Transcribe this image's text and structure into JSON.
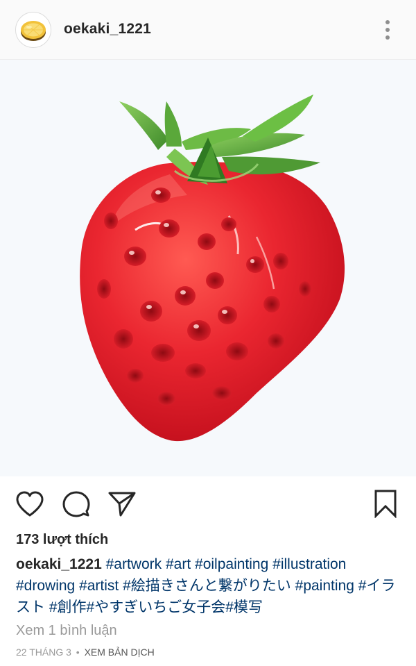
{
  "post": {
    "username": "oekaki_1221",
    "likes_text": "173 lượt thích",
    "caption": {
      "username": "oekaki_1221",
      "hashtags": [
        "#artwork",
        "#art",
        "#oilpainting",
        "#illustration",
        "#drowing",
        "#artist",
        "#絵描きさんと繋がりたい",
        "#painting",
        "#イラスト",
        "#創作",
        "#やすぎいちご女子会",
        "#模写"
      ]
    },
    "view_comments": "Xem 1 bình luận",
    "date": "22 THÁNG 3",
    "separator": "•",
    "translate": "XEM BẢN DỊCH"
  },
  "icons": {
    "avatar": "lemon-slice",
    "more": "more-vertical-icon",
    "like": "heart-icon",
    "comment": "comment-icon",
    "share": "paper-plane-icon",
    "save": "bookmark-icon"
  },
  "colors": {
    "text": "#262626",
    "hashtag": "#003569",
    "muted": "#999999",
    "strawberry": "#e8202a",
    "leaf": "#5aa83a"
  }
}
